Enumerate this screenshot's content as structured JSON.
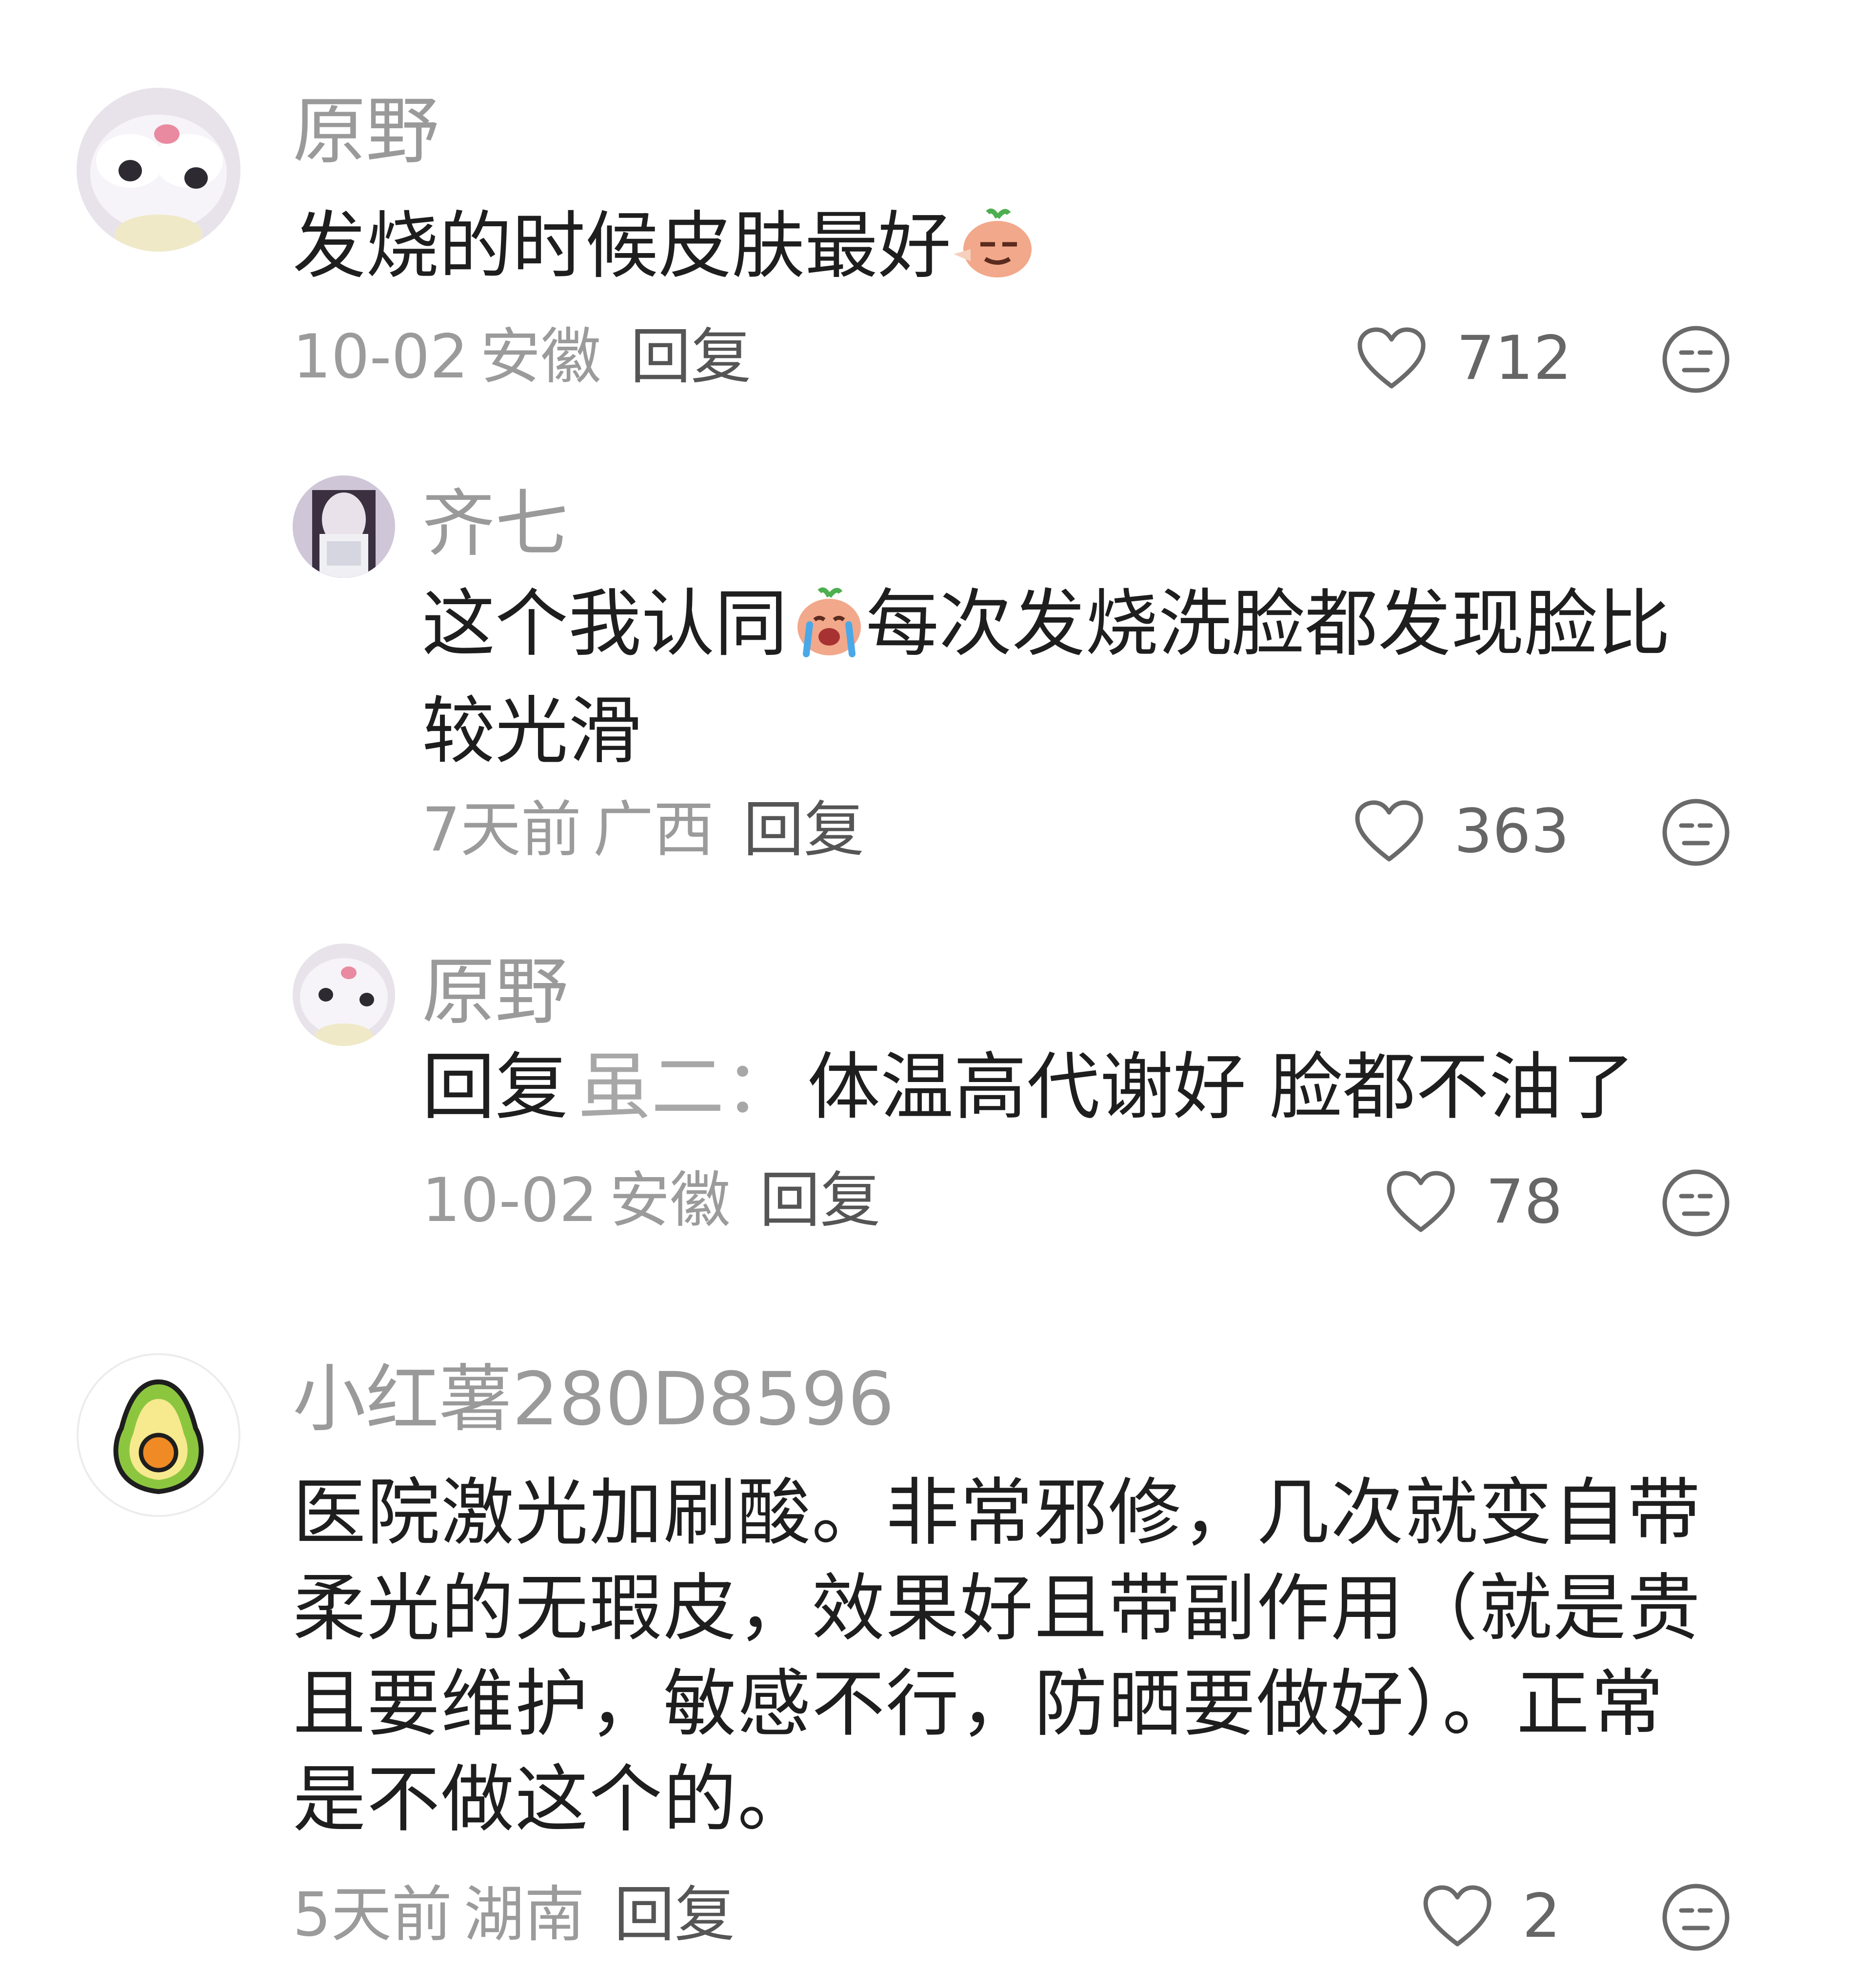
{
  "comments": [
    {
      "user": "原野",
      "text_before": "发烧的时候皮肤最好",
      "emoji": "sly-face-emoji",
      "date": "10-02",
      "region": "安徽",
      "reply_label": "回复",
      "likes": "712"
    },
    {
      "user": "齐七",
      "text_before": "这个我认同",
      "emoji": "crying-emoji",
      "text_after": "每次发烧洗脸都发现脸比较光滑",
      "date": "7天前",
      "region": "广西",
      "reply_label": "回复",
      "likes": "363"
    },
    {
      "user": "原野",
      "reply_prefix": "回复",
      "quoted_user": "虽二：",
      "text": "体温高代谢好 脸都不油了",
      "date": "10-02",
      "region": "安徽",
      "reply_label": "回复",
      "likes": "78"
    },
    {
      "user": "小红薯280D8596",
      "text": "医院激光加刷酸。非常邪修，几次就变自带柔光的无瑕皮，效果好且带副作用（就是贵且要维护，敏感不行，防晒要做好）。正常是不做这个的。",
      "date": "5天前",
      "region": "湖南",
      "reply_label": "回复",
      "likes": "2"
    }
  ],
  "colors": {
    "name": "#9a9a9a",
    "text": "#1e1e1e",
    "meta": "#9b9b9b",
    "icon": "#6a6a6a",
    "avocado_outer": "#8cc63f",
    "avocado_inner": "#f7e98e",
    "avocado_seed": "#f08a24"
  }
}
